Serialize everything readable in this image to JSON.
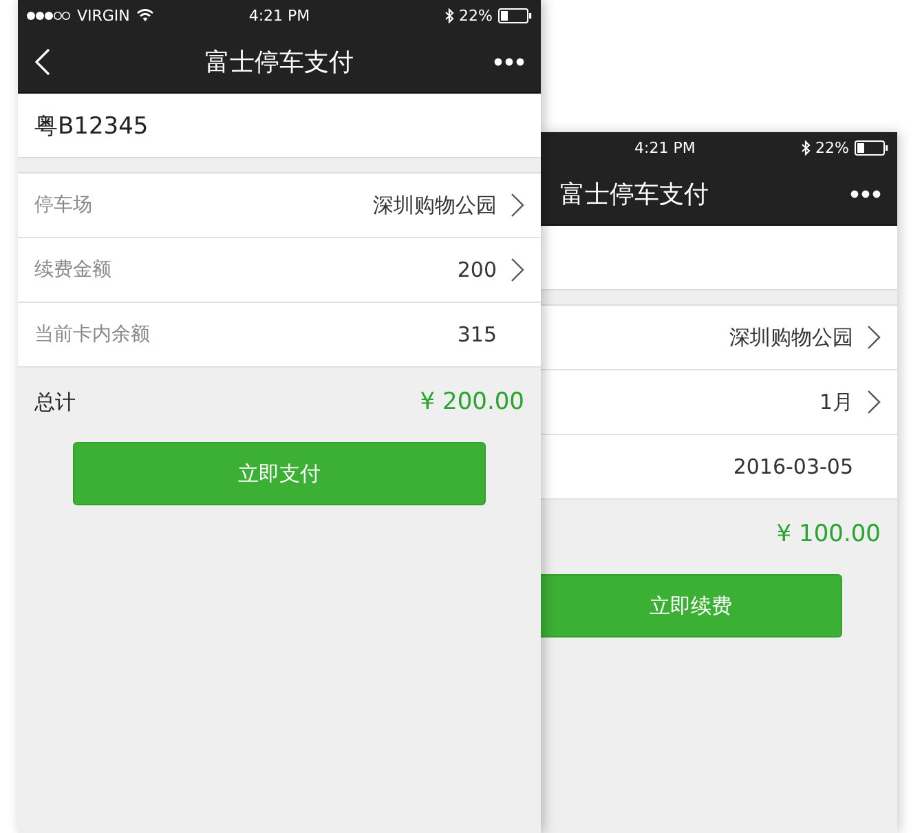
{
  "phones": [
    {
      "status_bar": {
        "carrier": "VIRGIN",
        "time": "4:21 PM",
        "battery": "22%"
      },
      "nav": {
        "back": true,
        "title": "富士停车支付"
      },
      "plate": "粤B12345",
      "rows": [
        {
          "label": "停车场",
          "value": "深圳购物公园",
          "chevron": true
        },
        {
          "label": "续费金额",
          "value": "200",
          "chevron": true
        },
        {
          "label": "当前卡内余额",
          "value": "315",
          "chevron": false
        }
      ],
      "total": {
        "label": "总计",
        "amount": "¥ 200.00"
      },
      "button": "立即支付"
    },
    {
      "status_bar": {
        "time": "4:21 PM",
        "battery": "22%"
      },
      "nav": {
        "title": "富士停车支付"
      },
      "rows": [
        {
          "value": "深圳购物公园",
          "chevron": true
        },
        {
          "value": "1月",
          "chevron": true
        },
        {
          "value": "2016-03-05",
          "chevron": false
        }
      ],
      "total": {
        "amount": "¥ 100.00"
      },
      "button": "立即续费"
    }
  ]
}
